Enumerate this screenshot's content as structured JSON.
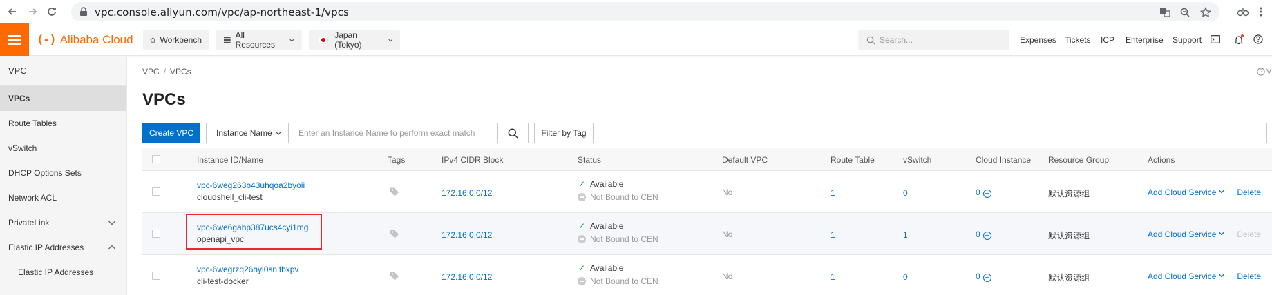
{
  "browser": {
    "url": "vpc.console.aliyun.com/vpc/ap-northeast-1/vpcs"
  },
  "topbar": {
    "brand_mark": "(-)",
    "brand_name": "Alibaba Cloud",
    "workbench": "Workbench",
    "all_resources": "All Resources",
    "region": "Japan (Tokyo)",
    "search_placeholder": "Search...",
    "links": [
      "Expenses",
      "Tickets",
      "ICP",
      "Enterprise",
      "Support"
    ],
    "accent_color": "#ff6a00"
  },
  "sidebar": {
    "title": "VPC",
    "items": [
      {
        "label": "VPCs",
        "active": true
      },
      {
        "label": "Route Tables"
      },
      {
        "label": "vSwitch"
      },
      {
        "label": "DHCP Options Sets"
      },
      {
        "label": "Network ACL"
      },
      {
        "label": "PrivateLink",
        "chevron": "down"
      },
      {
        "label": "Elastic IP Addresses",
        "chevron": "up"
      },
      {
        "label": "Elastic IP Addresses",
        "sub": true
      }
    ]
  },
  "main": {
    "breadcrumb": [
      "VPC",
      "VPCs"
    ],
    "help_text": "V",
    "title": "VPCs",
    "create_button": "Create VPC",
    "filter_select": "Instance Name",
    "filter_placeholder": "Enter an Instance Name to perform exact match",
    "filter_by_tag": "Filter by Tag"
  },
  "table": {
    "columns": [
      "Instance ID/Name",
      "Tags",
      "IPv4 CIDR Block",
      "Status",
      "Default VPC",
      "Route Table",
      "vSwitch",
      "Cloud Instance",
      "Resource Group",
      "Actions"
    ],
    "rows": [
      {
        "id": "vpc-6weg263b43uhqoa2byoii",
        "name": "cloudshell_cli-test",
        "cidr": "172.16.0.0/12",
        "status": "Available",
        "cen": "Not Bound to CEN",
        "default_vpc": "No",
        "route_table": "1",
        "vswitch": "0",
        "cloud_instance": "0",
        "resource_group": "默认资源组",
        "action_add": "Add Cloud Service",
        "action_delete": "Delete",
        "delete_enabled": true
      },
      {
        "id": "vpc-6we6gahp387ucs4cyi1mg",
        "name": "openapi_vpc",
        "cidr": "172.16.0.0/12",
        "status": "Available",
        "cen": "Not Bound to CEN",
        "default_vpc": "No",
        "route_table": "1",
        "vswitch": "1",
        "cloud_instance": "0",
        "resource_group": "默认资源组",
        "action_add": "Add Cloud Service",
        "action_delete": "Delete",
        "delete_enabled": false,
        "highlighted": true
      },
      {
        "id": "vpc-6wegrzq26hyl0snlfbxpv",
        "name": "cli-test-docker",
        "cidr": "172.16.0.0/12",
        "status": "Available",
        "cen": "Not Bound to CEN",
        "default_vpc": "No",
        "route_table": "1",
        "vswitch": "0",
        "cloud_instance": "0",
        "resource_group": "默认资源组",
        "action_add": "Add Cloud Service",
        "action_delete": "Delete",
        "delete_enabled": true
      }
    ]
  }
}
